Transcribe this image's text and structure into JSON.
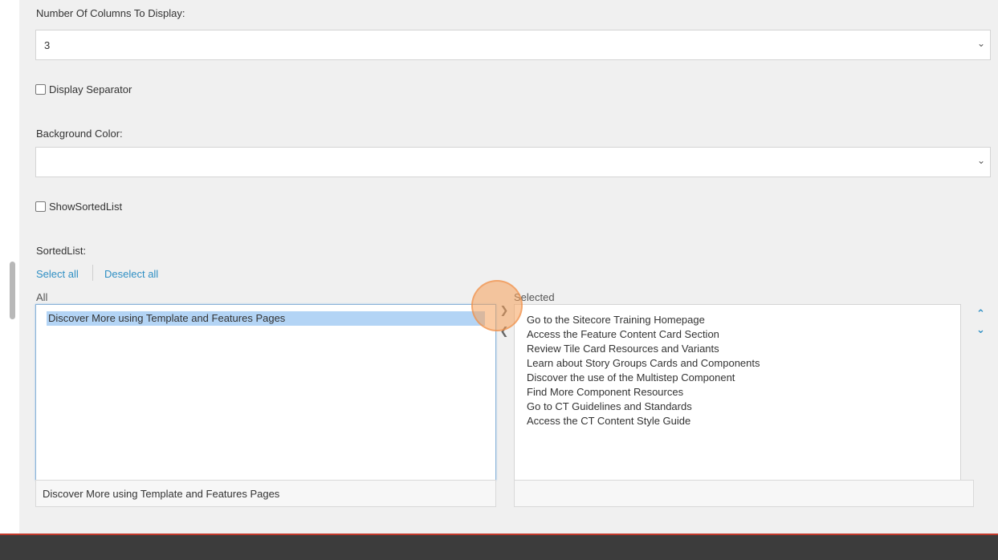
{
  "form": {
    "columns_label": "Number Of Columns To Display:",
    "columns_value": "3",
    "display_separator_label": "Display Separator",
    "background_color_label": "Background Color:",
    "background_color_value": "",
    "show_sorted_list_label": "ShowSortedList",
    "sorted_list_label": "SortedList:"
  },
  "multilist": {
    "select_all": "Select all",
    "deselect_all": "Deselect all",
    "all_header": "All",
    "selected_header": "Selected",
    "all_items": [
      "Discover More using Template and Features Pages"
    ],
    "selected_items": [
      "Go to the Sitecore Training Homepage",
      "Access the Feature Content Card Section",
      "Review Tile Card Resources and Variants",
      "Learn about Story Groups Cards and Components",
      "Discover the use of the Multistep Component",
      "Find More Component Resources",
      "Go to CT Guidelines and Standards",
      "Access the CT Content Style Guide"
    ],
    "all_footer": "Discover More using Template and Features Pages",
    "selected_footer": ""
  },
  "icons": {
    "chevron_down": "chevron-down-icon",
    "add_arrow": "chevron-right-icon",
    "remove_arrow": "chevron-left-icon",
    "move_up": "chevron-up-icon",
    "move_down": "chevron-down-icon"
  },
  "colors": {
    "link": "#2f8fc4",
    "selection": "#b3d4f5",
    "highlight": "#f6a05a",
    "bottom_bar": "#3c3c3c",
    "bottom_accent": "#c0392b"
  }
}
